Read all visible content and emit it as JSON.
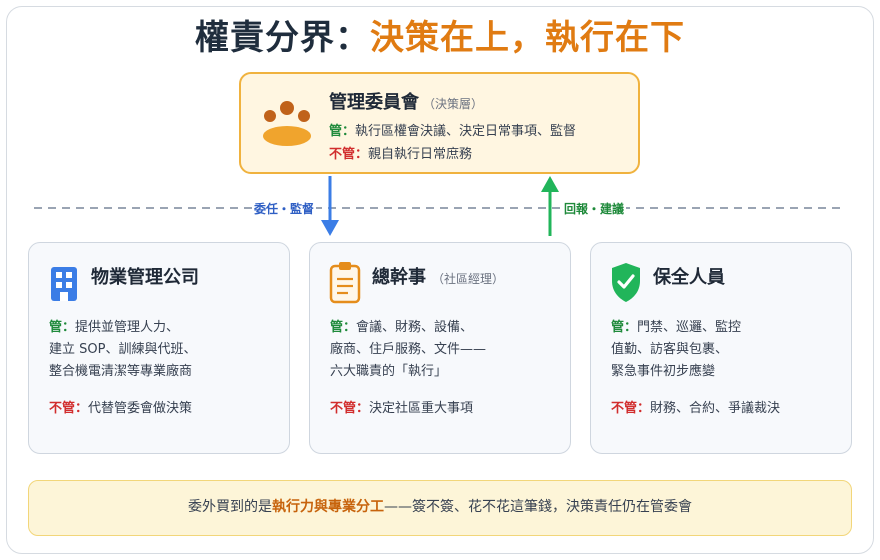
{
  "title": {
    "lead": "權責分界：",
    "accent": "決策在上，執行在下"
  },
  "committee": {
    "name": "管理委員會",
    "sub": "（決策層）",
    "manage_key": "管：",
    "manage_text": "執行區權會決議、決定日常事項、監督",
    "notmanage_key": "不管：",
    "notmanage_text": "親自執行日常庶務"
  },
  "connectors": {
    "down_label": "委任・監督",
    "up_label": "回報・建議",
    "down_color": "#3b7de6",
    "up_color": "#21b55a"
  },
  "cards": [
    {
      "name": "物業管理公司",
      "sub": "",
      "icon": "building-icon",
      "manage_key": "管：",
      "manage_lines": [
        "提供並管理人力、",
        "建立 SOP、訓練與代班、",
        "整合機電清潔等專業廠商"
      ],
      "notmanage_key": "不管：",
      "notmanage_text": "代替管委會做決策"
    },
    {
      "name": "總幹事",
      "sub": "（社區經理）",
      "icon": "clipboard-icon",
      "manage_key": "管：",
      "manage_lines": [
        "會議、財務、設備、",
        "廠商、住戶服務、文件——",
        "六大職責的「執行」"
      ],
      "notmanage_key": "不管：",
      "notmanage_text": "決定社區重大事項"
    },
    {
      "name": "保全人員",
      "sub": "",
      "icon": "shield-check-icon",
      "manage_key": "管：",
      "manage_lines": [
        "門禁、巡邏、監控",
        "值勤、訪客與包裹、",
        "緊急事件初步應變"
      ],
      "notmanage_key": "不管：",
      "notmanage_text": "財務、合約、爭議裁決"
    }
  ],
  "footer": {
    "pre": "委外買到的是",
    "highlight": "執行力與專業分工",
    "post": "——簽不簽、花不花這筆錢，決策責任仍在管委會"
  },
  "colors": {
    "accent_orange": "#e07b12",
    "committee_fill": "#fff6e1",
    "committee_border": "#f0b23e",
    "card_fill": "#f7f9fc",
    "manage_green": "#1f8a3b",
    "notmanage_red": "#d12d2d"
  }
}
